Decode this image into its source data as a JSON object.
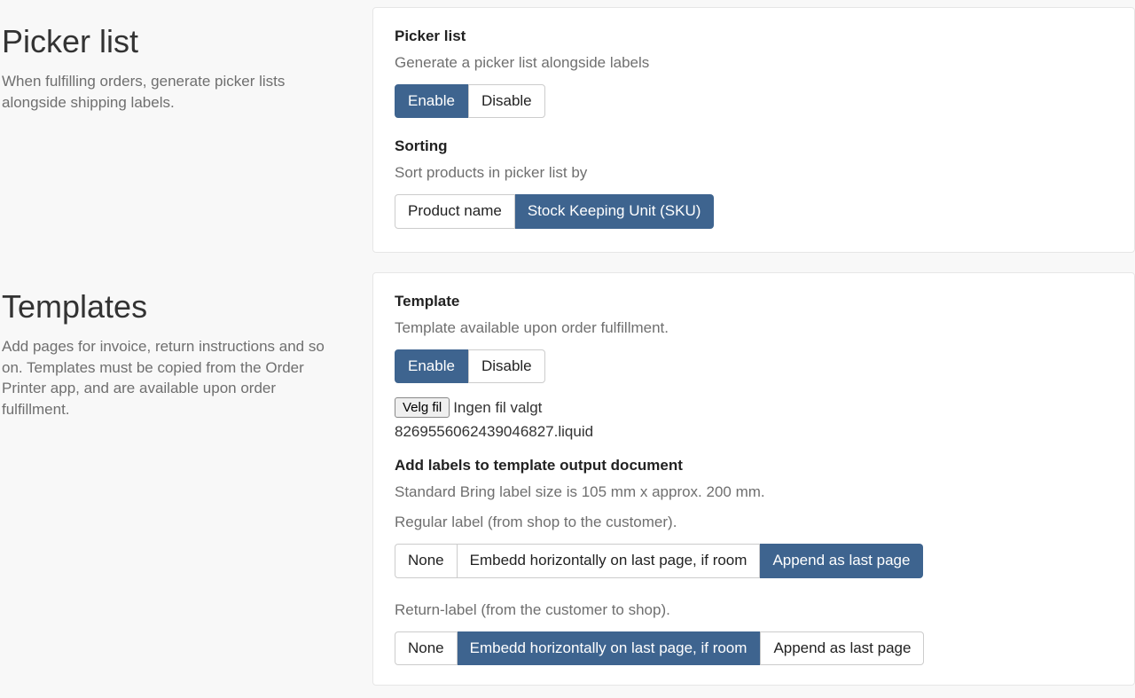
{
  "picker": {
    "title": "Picker list",
    "intro": "When fulfilling orders, generate picker lists alongside shipping labels.",
    "card": {
      "heading": "Picker list",
      "desc": "Generate a picker list alongside labels",
      "enable": "Enable",
      "disable": "Disable",
      "sorting_heading": "Sorting",
      "sorting_desc": "Sort products in picker list by",
      "sort_name": "Product name",
      "sort_sku": "Stock Keeping Unit (SKU)"
    }
  },
  "templates": {
    "title": "Templates",
    "intro": "Add pages for invoice, return instructions and so on. Templates must be copied from the Order Printer app, and are available upon order fulfillment.",
    "card": {
      "heading": "Template",
      "desc": "Template available upon order fulfillment.",
      "enable": "Enable",
      "disable": "Disable",
      "file_button": "Velg fil",
      "file_status": "Ingen fil valgt",
      "filename": "8269556062439046827.liquid",
      "labels_heading": "Add labels to template output document",
      "labels_desc": "Standard Bring label size is 105 mm x approx. 200 mm.",
      "regular_desc": "Regular label (from shop to the customer).",
      "return_desc": "Return-label (from the customer to shop).",
      "opt_none": "None",
      "opt_embed": "Embedd horizontally on last page, if room",
      "opt_append": "Append as last page"
    }
  }
}
